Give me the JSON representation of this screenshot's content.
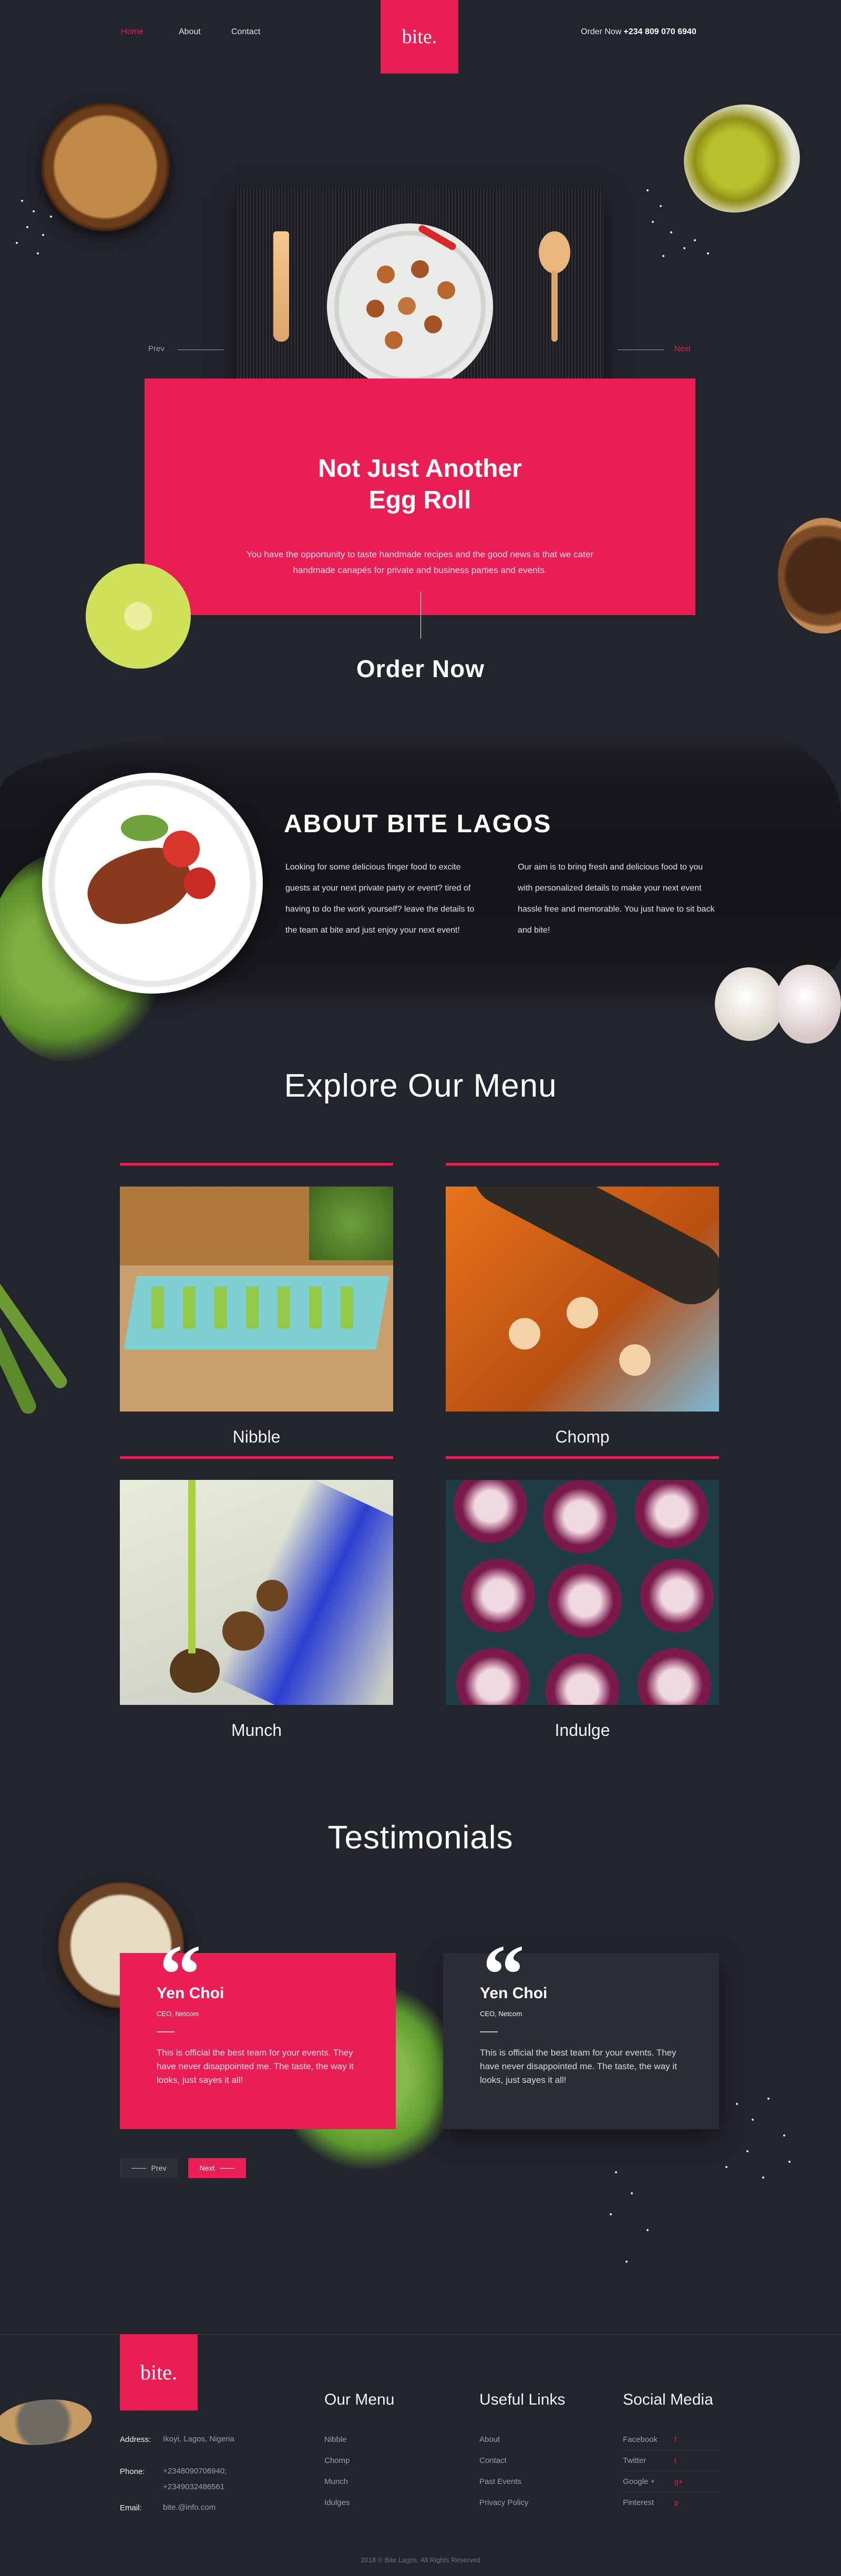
{
  "nav": {
    "links": [
      "Home",
      "About",
      "Contact"
    ],
    "logo": "bite.",
    "phone_label": "Order Now",
    "phone_number": "+234 809 070 6940"
  },
  "hero": {
    "prev": "Prev",
    "next": "Next",
    "title_line1": "Not Just Another",
    "title_line2": "Egg Roll",
    "subtitle": "You have the opportunity to taste handmade recipes and the good news is that we cater handmade canapés for private and business parties and events.",
    "cta": "Order Now"
  },
  "about": {
    "title": "ABOUT BITE LAGOS",
    "col1": "Looking for some delicious finger food to excite guests at your next private party or event? tired of having to do the work yourself? leave the details to the team at bite and just enjoy your next event!",
    "col2": "Our aim is to bring fresh and delicious food to you with personalized details to make your next event hassle free and memorable. You just have to sit back and bite!"
  },
  "menu": {
    "title": "Explore Our Menu",
    "items": [
      "Nibble",
      "Chomp",
      "Munch",
      "Indulge"
    ]
  },
  "testimonials": {
    "title": "Testimonials",
    "cards": [
      {
        "name": "Yen Choi",
        "role": "CEO, Netcom",
        "text": "This is official the best team for your events. They have never disappointed me. The taste, the way it looks, just sayes it all!"
      },
      {
        "name": "Yen Choi",
        "role": "CEO, Netcom",
        "text": "This is official the best team for your events. They have never disappointed me. The taste, the way it looks, just sayes it all!"
      }
    ],
    "prev": "Prev",
    "next": "Next"
  },
  "footer": {
    "logo": "bite.",
    "address_label": "Address:",
    "address": "Ikoyi, Lagos, Nigeria",
    "phone_label": "Phone:",
    "phone1": "+2348090706940;",
    "phone2": "+2349032486561",
    "email_label": "Email:",
    "email": "bite.@info.com",
    "menu_title": "Our Menu",
    "menu_items": [
      "Nibble",
      "Chomp",
      "Munch",
      "Idulges"
    ],
    "links_title": "Useful Links",
    "links_items": [
      "About",
      "Contact",
      "Past Events",
      "Privacy Policy"
    ],
    "social_title": "Social Media",
    "social_items": [
      "Facebook",
      "Twitter",
      "Google +",
      "Pinterest"
    ],
    "social_icons": [
      "f",
      "t",
      "g+",
      "p"
    ],
    "copyright": "2018 © Bite Lagos. All Rights Reserved"
  },
  "colors": {
    "accent": "#e91e55",
    "background": "#23252d",
    "card_dark": "#2c2e36"
  }
}
